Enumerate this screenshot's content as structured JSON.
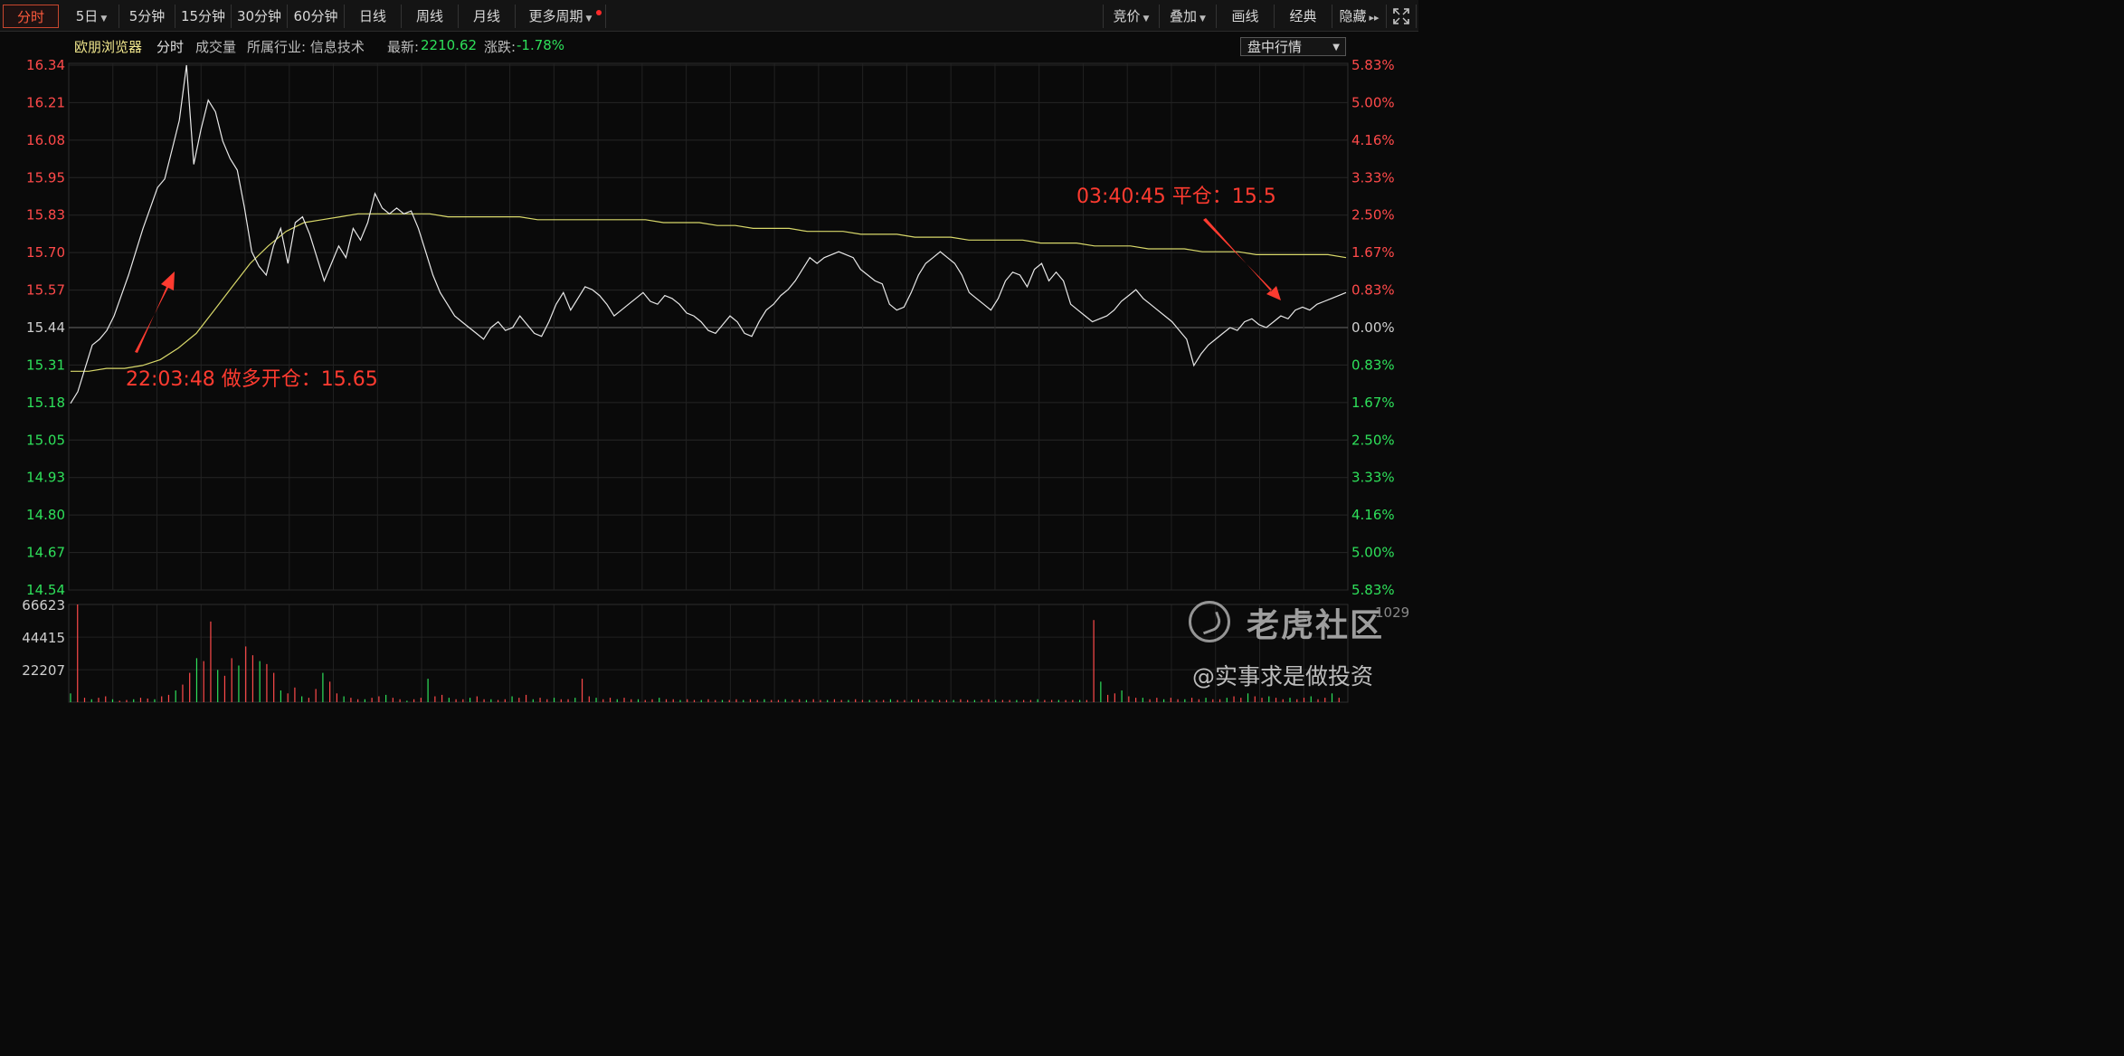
{
  "toolbar": {
    "left_tabs": [
      {
        "label": "分时",
        "active": true
      },
      {
        "label": "5日",
        "dropdown": true
      },
      {
        "label": "5分钟"
      },
      {
        "label": "15分钟"
      },
      {
        "label": "30分钟"
      },
      {
        "label": "60分钟"
      },
      {
        "label": "日线"
      },
      {
        "label": "周线"
      },
      {
        "label": "月线"
      },
      {
        "label": "更多周期",
        "dropdown": true,
        "badge": "red-dot"
      }
    ],
    "right_tabs": [
      {
        "label": "竞价",
        "dropdown": true
      },
      {
        "label": "叠加",
        "dropdown": true
      },
      {
        "label": "画线"
      },
      {
        "label": "经典"
      },
      {
        "label": "隐藏"
      }
    ],
    "icons": [
      "double-chevron-right-icon",
      "fullscreen-icon"
    ]
  },
  "info_bar": {
    "name": "欧朋浏览器",
    "mode": "分时",
    "volume_label": "成交量",
    "industry": "所属行业: 信息技术",
    "latest_label": "最新:",
    "latest_value": "2210.62",
    "change_label": "涨跌:",
    "change_value": "-1.78%",
    "dropdown": "盘中行情"
  },
  "chart_data": {
    "type": "line",
    "y_ticks": [
      "16.34",
      "16.21",
      "16.08",
      "15.95",
      "15.83",
      "15.70",
      "15.57",
      "15.44",
      "15.31",
      "15.18",
      "15.05",
      "14.93",
      "14.80",
      "14.67",
      "14.54"
    ],
    "pct_ticks": [
      "5.83%",
      "5.00%",
      "4.16%",
      "3.33%",
      "2.50%",
      "1.67%",
      "0.83%",
      "0.00%",
      "0.83%",
      "1.67%",
      "2.50%",
      "3.33%",
      "4.16%",
      "5.00%",
      "5.83%"
    ],
    "prev_close": 15.44,
    "ylim": [
      14.54,
      16.34
    ],
    "series": [
      {
        "values": [
          15.18,
          15.22,
          15.3,
          15.38,
          15.4,
          15.43,
          15.48,
          15.55,
          15.62,
          15.7,
          15.78,
          15.85,
          15.92,
          15.95,
          16.05,
          16.15,
          16.34,
          16.0,
          16.12,
          16.22,
          16.18,
          16.08,
          16.02,
          15.98,
          15.85,
          15.7,
          15.65,
          15.62,
          15.72,
          15.78,
          15.66,
          15.8,
          15.82,
          15.76,
          15.68,
          15.6,
          15.66,
          15.72,
          15.68,
          15.78,
          15.74,
          15.8,
          15.9,
          15.85,
          15.83,
          15.85,
          15.83,
          15.84,
          15.78,
          15.7,
          15.62,
          15.56,
          15.52,
          15.48,
          15.46,
          15.44,
          15.42,
          15.4,
          15.44,
          15.46,
          15.43,
          15.44,
          15.48,
          15.45,
          15.42,
          15.41,
          15.46,
          15.52,
          15.56,
          15.5,
          15.54,
          15.58,
          15.57,
          15.55,
          15.52,
          15.48,
          15.5,
          15.52,
          15.54,
          15.56,
          15.53,
          15.52,
          15.55,
          15.54,
          15.52,
          15.49,
          15.48,
          15.46,
          15.43,
          15.42,
          15.45,
          15.48,
          15.46,
          15.42,
          15.41,
          15.46,
          15.5,
          15.52,
          15.55,
          15.57,
          15.6,
          15.64,
          15.68,
          15.66,
          15.68,
          15.69,
          15.7,
          15.69,
          15.68,
          15.64,
          15.62,
          15.6,
          15.59,
          15.52,
          15.5,
          15.51,
          15.56,
          15.62,
          15.66,
          15.68,
          15.7,
          15.68,
          15.66,
          15.62,
          15.56,
          15.54,
          15.52,
          15.5,
          15.54,
          15.6,
          15.63,
          15.62,
          15.58,
          15.64,
          15.66,
          15.6,
          15.63,
          15.6,
          15.52,
          15.5,
          15.48,
          15.46,
          15.47,
          15.48,
          15.5,
          15.53,
          15.55,
          15.57,
          15.54,
          15.52,
          15.5,
          15.48,
          15.46,
          15.43,
          15.4,
          15.31,
          15.35,
          15.38,
          15.4,
          15.42,
          15.44,
          15.43,
          15.46,
          15.47,
          15.45,
          15.44,
          15.46,
          15.48,
          15.47,
          15.5,
          15.51,
          15.5,
          15.52,
          15.53,
          15.54,
          15.55,
          15.56
        ]
      },
      {
        "values": [
          15.29,
          15.29,
          15.3,
          15.3,
          15.31,
          15.33,
          15.37,
          15.42,
          15.5,
          15.58,
          15.66,
          15.72,
          15.77,
          15.8,
          15.81,
          15.82,
          15.83,
          15.83,
          15.83,
          15.83,
          15.83,
          15.82,
          15.82,
          15.82,
          15.82,
          15.82,
          15.81,
          15.81,
          15.81,
          15.81,
          15.81,
          15.81,
          15.81,
          15.8,
          15.8,
          15.8,
          15.79,
          15.79,
          15.78,
          15.78,
          15.78,
          15.77,
          15.77,
          15.77,
          15.76,
          15.76,
          15.76,
          15.75,
          15.75,
          15.75,
          15.74,
          15.74,
          15.74,
          15.74,
          15.73,
          15.73,
          15.73,
          15.72,
          15.72,
          15.72,
          15.71,
          15.71,
          15.71,
          15.7,
          15.7,
          15.7,
          15.69,
          15.69,
          15.69,
          15.69,
          15.69,
          15.68
        ]
      }
    ],
    "volume": {
      "y_ticks": [
        "66623",
        "44415",
        "22207"
      ],
      "ylim": [
        0,
        66623
      ],
      "values": [
        6000,
        66623,
        3000,
        2000,
        3000,
        4000,
        2000,
        1000,
        1500,
        2000,
        3000,
        2500,
        2000,
        4000,
        5000,
        8000,
        12000,
        20000,
        30000,
        28000,
        55000,
        22000,
        18000,
        30000,
        25000,
        38000,
        32000,
        28000,
        26000,
        20000,
        8000,
        6000,
        10000,
        4000,
        3000,
        9000,
        20000,
        14000,
        6000,
        4000,
        3000,
        2000,
        2000,
        3000,
        4000,
        5000,
        3000,
        2000,
        1000,
        2000,
        3000,
        16000,
        4000,
        5000,
        3000,
        2000,
        2000,
        3000,
        4000,
        2000,
        2000,
        1500,
        2000,
        4000,
        3000,
        5000,
        2000,
        3000,
        2000,
        3000,
        2000,
        2000,
        3000,
        16000,
        4000,
        3000,
        2000,
        3000,
        2000,
        3000,
        2000,
        2000,
        1500,
        2000,
        3000,
        2000,
        2000,
        1500,
        2000,
        1500,
        1500,
        2000,
        1500,
        1500,
        1500,
        2000,
        1500,
        2000,
        1500,
        2000,
        1500,
        1500,
        2000,
        1500,
        2000,
        1500,
        2000,
        1500,
        1500,
        2000,
        1500,
        1500,
        2000,
        1500,
        1500,
        1500,
        1500,
        2000,
        1500,
        1500,
        1500,
        2000,
        1500,
        1500,
        1500,
        1500,
        1500,
        2000,
        1500,
        1500,
        1500,
        2000,
        1500,
        1500,
        1500,
        1500,
        1500,
        1500,
        2000,
        1500,
        1500,
        1500,
        1500,
        1500,
        1500,
        1500,
        56000,
        14000,
        5000,
        6000,
        8000,
        4000,
        3000,
        3000,
        2000,
        3000,
        2000,
        3000,
        2000,
        2000,
        3000,
        2000,
        3000,
        2000,
        2000,
        3000,
        4000,
        3000,
        6000,
        4000,
        3000,
        4000,
        3000,
        2000,
        3000,
        2000,
        3000,
        4000,
        2000,
        3000,
        6000,
        3000
      ]
    },
    "annotations": [
      {
        "text": "22:03:48 做多开仓：15.65"
      },
      {
        "text": "03:40:45 平仓：15.5"
      }
    ]
  },
  "colors": {
    "up": "#ff4a4a",
    "down": "#2ee05a",
    "price_line": "#e8e8e8",
    "avg_line": "#d8d86a",
    "annotation": "#ff3b30"
  },
  "watermark": {
    "brand": "老虎社区",
    "handle": "@实事求是做投资",
    "corner_number": "1029"
  }
}
